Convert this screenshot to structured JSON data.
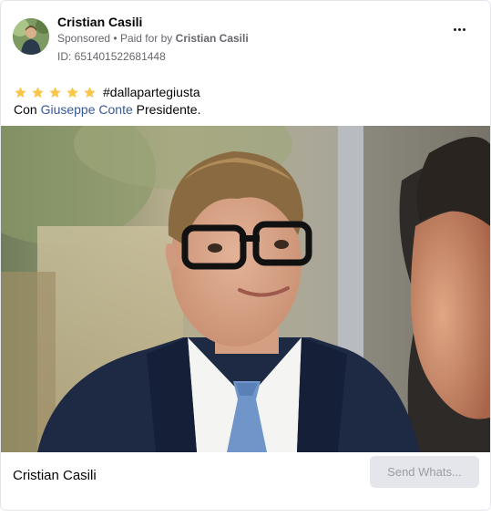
{
  "ad": {
    "page_name": "Cristian Casili",
    "sponsored_label": "Sponsored",
    "separator": "•",
    "paid_for_prefix": "Paid for by",
    "paid_for_name": "Cristian Casili",
    "ad_id": "ID: 651401522681448",
    "more_icon": "more-horizontal-icon"
  },
  "body": {
    "rating_stars": 5,
    "star_icon": "star-icon",
    "star_color": "#f7c64a",
    "hashtag": "#dallapartegiusta",
    "line2_prefix": "Con",
    "line2_mention": "Giuseppe Conte",
    "line2_suffix": "Presidente."
  },
  "cta": {
    "title": "Cristian Casili",
    "button_label": "Send Whats..."
  },
  "colors": {
    "link": "#385898",
    "secondary_text": "#65676b",
    "button_bg": "#e4e6eb",
    "button_text": "#9a9da3"
  }
}
